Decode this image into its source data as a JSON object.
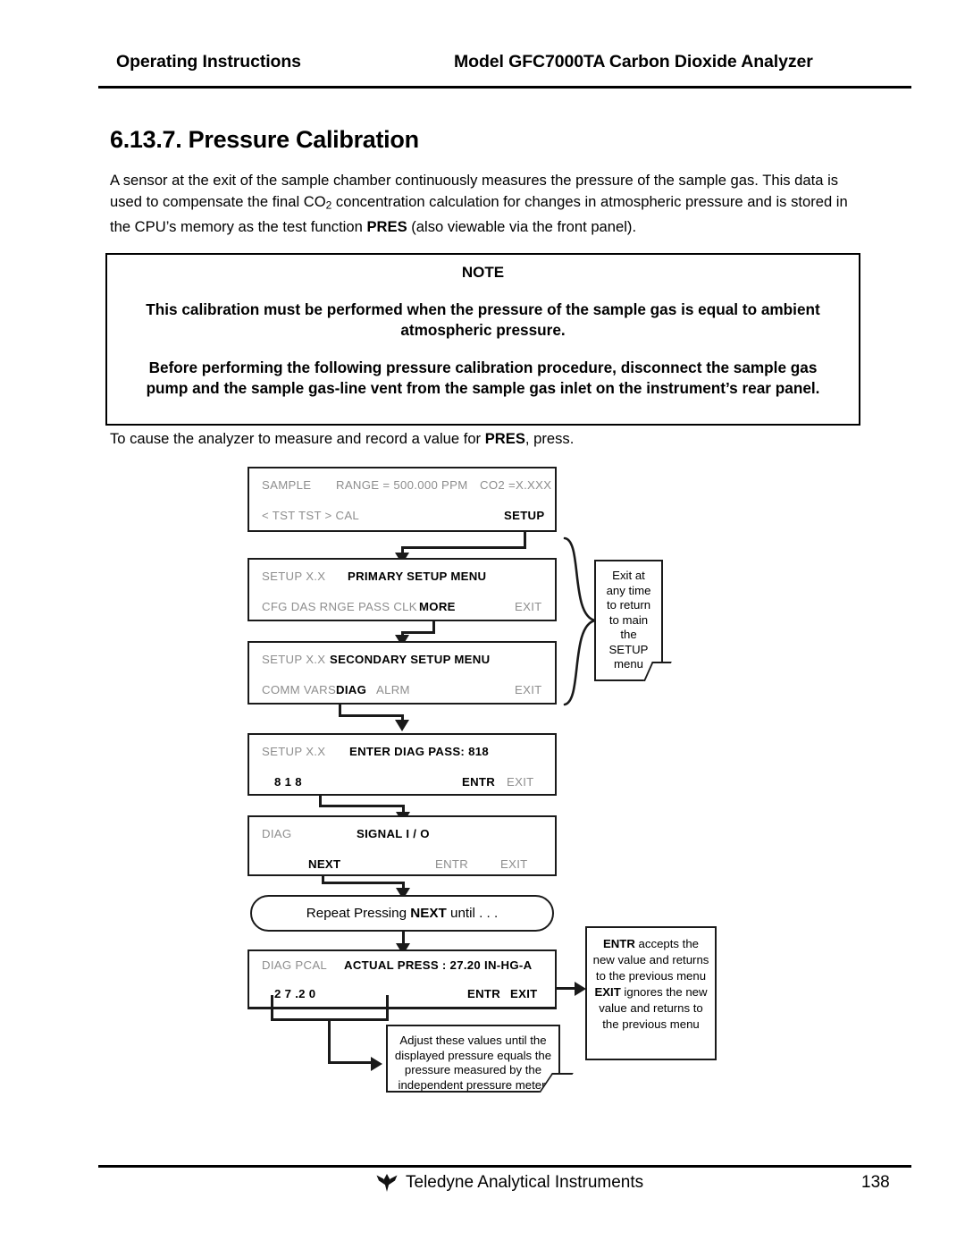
{
  "header": {
    "left": "Operating Instructions",
    "right": "Model GFC7000TA Carbon Dioxide Analyzer"
  },
  "section": {
    "number_title": "6.13.7. Pressure Calibration"
  },
  "intro": {
    "line1_a": "A sensor at the exit of the sample chamber continuously measures the pressure of the sample gas.  This data is used to compensate the final CO",
    "sub1": "2",
    "line1_b": " concentration calculation for changes in atmospheric pressure and is stored in the CPU’s memory as the test function ",
    "pres": "PRES",
    "line1_c": " (also viewable via the front panel)."
  },
  "note": {
    "title": "NOTE",
    "paragraph1": "This calibration must be performed when the pressure of the sample gas is equal to ambient atmospheric pressure.",
    "paragraph2": "Before performing the following pressure calibration procedure, disconnect the sample gas pump and the sample gas-line vent from the sample gas inlet on the instrument’s rear panel."
  },
  "cause": {
    "text_a": "To cause the analyzer to measure and record a value for ",
    "pres": "PRES",
    "text_b": ", press."
  },
  "flow": {
    "panel1": {
      "row1_left": "SAMPLE",
      "row1_mid": "RANGE = 500.000 PPM",
      "row1_right": "CO2 =X.XXX",
      "row2_left": "< TST  TST >  CAL",
      "row2_right": "SETUP"
    },
    "panel2": {
      "row1_left": "SETUP X.X",
      "row1_title": "PRIMARY SETUP MENU",
      "row2_keys": "CFG  DAS  RNGE  PASS  CLK",
      "row2_more": "MORE",
      "row2_exit": "EXIT"
    },
    "panel3": {
      "row1_left": "SETUP X.X",
      "row1_title": "SECONDARY SETUP MENU",
      "row2_keys_a": "COMM  VARS",
      "row2_diag": "DIAG",
      "row2_keys_b": "ALRM",
      "row2_exit": "EXIT"
    },
    "panel4": {
      "row1_left": "SETUP X.X",
      "row1_title": "ENTER DIAG PASS: 818",
      "row2_digits": "8     1     8",
      "row2_entr": "ENTR",
      "row2_exit": "EXIT"
    },
    "panel5": {
      "row1_left": "DIAG",
      "row1_title": "SIGNAL I / O",
      "row2_next": "NEXT",
      "row2_entr": "ENTR",
      "row2_exit": "EXIT"
    },
    "repeat_box": {
      "text_a": "Repeat Pressing ",
      "next": "NEXT",
      "text_b": " until . . ."
    },
    "panel6": {
      "row1_left": "DIAG PCAL",
      "row1_title": "ACTUAL PRESS : 27.20 IN-HG-A",
      "row2_digits": "2      7      .2      0",
      "row2_entr": "ENTR",
      "row2_exit": "EXIT"
    },
    "callout_exit": {
      "text": "Exit at any time to return to main the SETUP menu"
    },
    "callout_entr": {
      "entr": "ENTR",
      "text_a": " accepts the new value and returns to the previous menu ",
      "exit": "EXIT",
      "text_b": " ignores the new value and returns to the previous menu"
    },
    "callout_adjust": {
      "text": "Adjust these values until the displayed pressure equals the pressure measured by the independent pressure meter."
    }
  },
  "footer": {
    "company": "Teledyne Analytical Instruments",
    "page_number": "138"
  }
}
